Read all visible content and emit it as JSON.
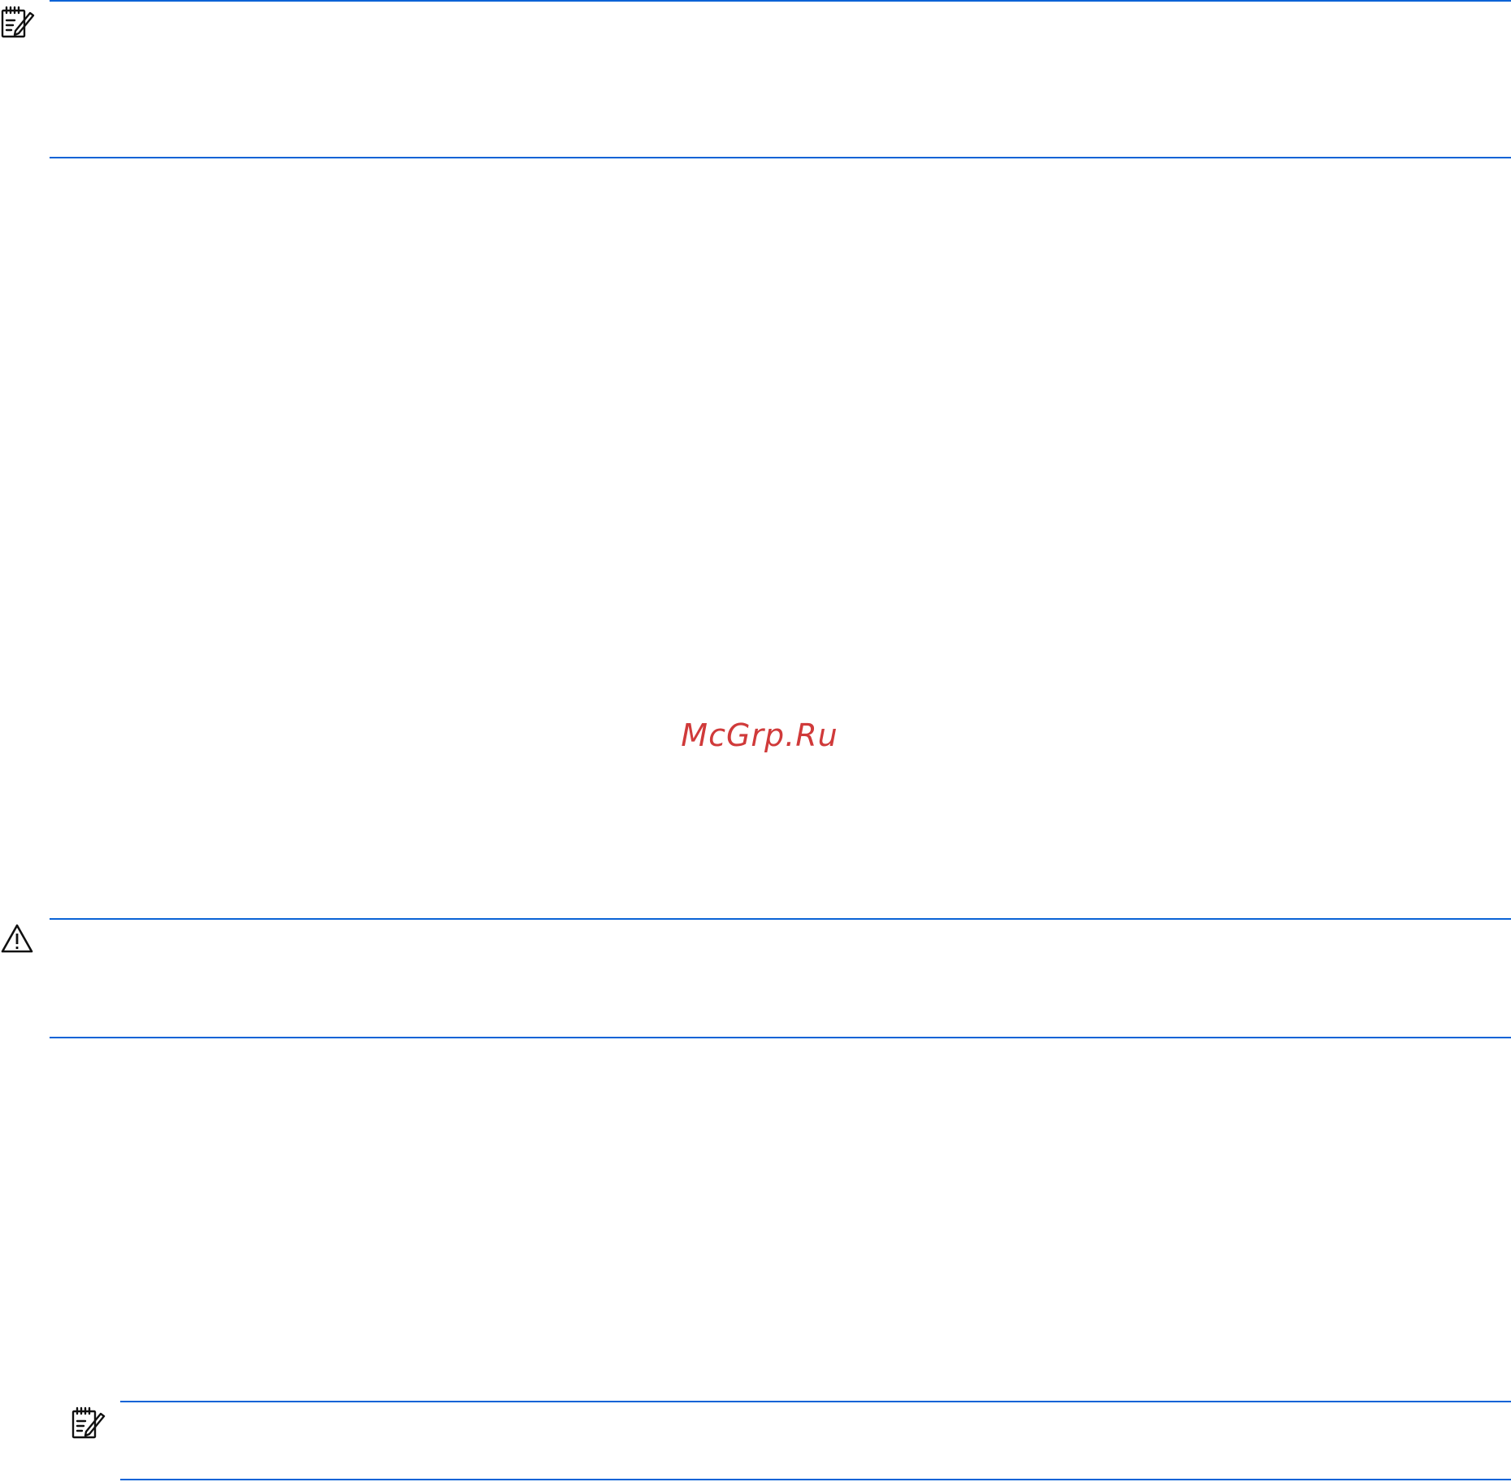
{
  "watermark": {
    "text": "McGrp.Ru",
    "color": "#d03a3a"
  },
  "colors": {
    "rule": "#0a63d6",
    "icon": "#111111"
  },
  "callouts": [
    {
      "kind": "note",
      "icon": "note-icon"
    },
    {
      "kind": "caution",
      "icon": "warning-triangle-icon"
    },
    {
      "kind": "note",
      "icon": "note-icon"
    }
  ]
}
